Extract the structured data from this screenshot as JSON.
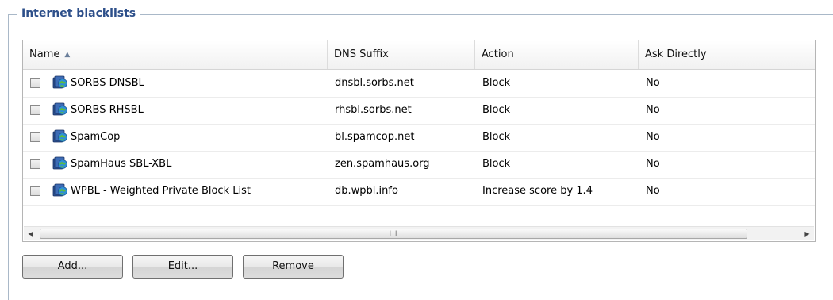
{
  "group": {
    "title": "Internet blacklists"
  },
  "grid": {
    "columns": [
      {
        "label": "Name",
        "sorted": "ascending"
      },
      {
        "label": "DNS Suffix"
      },
      {
        "label": "Action"
      },
      {
        "label": "Ask Directly"
      }
    ],
    "rows": [
      {
        "name": "SORBS DNSBL",
        "dns_suffix": "dnsbl.sorbs.net",
        "action": "Block",
        "ask_directly": "No",
        "checked": false
      },
      {
        "name": "SORBS RHSBL",
        "dns_suffix": "rhsbl.sorbs.net",
        "action": "Block",
        "ask_directly": "No",
        "checked": false
      },
      {
        "name": "SpamCop",
        "dns_suffix": "bl.spamcop.net",
        "action": "Block",
        "ask_directly": "No",
        "checked": false
      },
      {
        "name": "SpamHaus SBL-XBL",
        "dns_suffix": "zen.spamhaus.org",
        "action": "Block",
        "ask_directly": "No",
        "checked": false
      },
      {
        "name": "WPBL - Weighted Private Block List",
        "dns_suffix": "db.wpbl.info",
        "action": "Increase score by 1.4",
        "ask_directly": "No",
        "checked": false
      }
    ],
    "row_icon": "globe-blacklist-icon",
    "scroll_grip": "III"
  },
  "buttons": {
    "add": "Add...",
    "edit": "Edit...",
    "remove": "Remove"
  },
  "colors": {
    "legend": "#2d4f8a",
    "groupbox_border": "#a9b8c8"
  }
}
